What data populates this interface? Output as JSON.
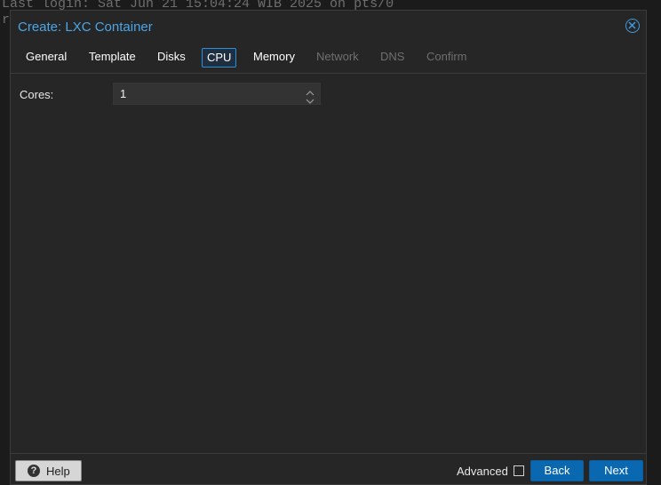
{
  "terminal": {
    "line1": "Last login: Sat Jun 21 15:04:24 WIB 2025 on pts/0",
    "line2": "r"
  },
  "dialog": {
    "title": "Create: LXC Container",
    "close_icon": "close-circle-icon"
  },
  "tabs": [
    {
      "label": "General",
      "state": "enabled"
    },
    {
      "label": "Template",
      "state": "enabled"
    },
    {
      "label": "Disks",
      "state": "enabled"
    },
    {
      "label": "CPU",
      "state": "active"
    },
    {
      "label": "Memory",
      "state": "enabled"
    },
    {
      "label": "Network",
      "state": "disabled"
    },
    {
      "label": "DNS",
      "state": "disabled"
    },
    {
      "label": "Confirm",
      "state": "disabled"
    }
  ],
  "cpu": {
    "cores_label": "Cores:",
    "cores_value": "1"
  },
  "footer": {
    "help_label": "Help",
    "help_icon": "question-circle-icon",
    "advanced_label": "Advanced",
    "advanced_checked": false,
    "back_label": "Back",
    "next_label": "Next"
  },
  "colors": {
    "accent": "#2d8fd8",
    "title": "#4aa6e8",
    "primary_button": "#0a68b0",
    "disabled_text": "#6f6f6f",
    "panel_bg": "#262626"
  }
}
